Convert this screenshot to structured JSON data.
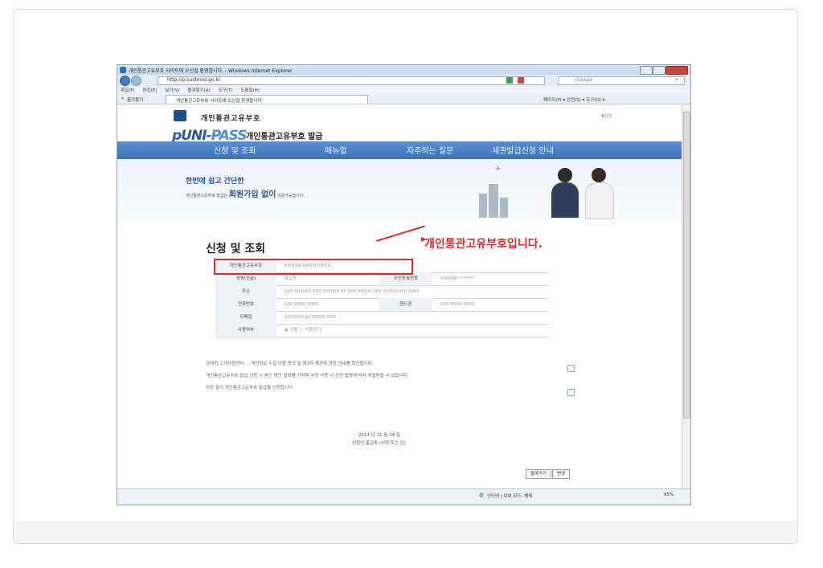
{
  "browser": {
    "window_title": "개인통관고유부호 사이트에 오신걸 환영합니다. - Windows Internet Explorer",
    "url": "http://p.customs.go.kr",
    "search_placeholder": "Google",
    "menu": [
      "파일(F)",
      "편집(E)",
      "보기(V)",
      "즐겨찾기(A)",
      "도구(T)",
      "도움말(H)"
    ],
    "favorites_label": "즐겨찾기",
    "tab_title": "개인통관고유부호 사이트에 오신걸 환영합니다",
    "toolbar_right": "페이지(P) ▾ 안전(S) ▾ 도구(O) ▾",
    "status_zone": "인터넷 | 보호 모드: 해제",
    "zoom": "95%"
  },
  "site": {
    "name": "개인통관고유부호",
    "brand_main": "pUNI-",
    "brand_pass": "PASS",
    "brand_sub": "개인통관고유부호 발급",
    "login": "로그인",
    "nav": [
      "신청 및 조회",
      "매뉴얼",
      "자주하는 질문",
      "세관발급신청 안내"
    ],
    "hero_line1_a": "한번에 쉽고 ",
    "hero_line1_b": "간단한",
    "hero_line2_a": "개인통관고유부호 발급은 ",
    "hero_line2_b": "회원가입 없이",
    "hero_line2_c": " 이용가능합니다."
  },
  "main": {
    "title": "신청 및 조회",
    "callout": "개인통관고유부호입니다.",
    "rows": [
      {
        "label": "개인통관고유부호",
        "value": "P000000000000"
      },
      {
        "label": "성명(한글)",
        "value": "홍길동",
        "label2": "주민등록번호",
        "value2": "000000-*******"
      },
      {
        "label": "주소",
        "value": "000 000000 000 000000 00 000 00000 000 00000 000 0000"
      },
      {
        "label": "전화번호",
        "value": "000-0000-0000",
        "label2": "핸드폰",
        "value2": "000-0000-0000"
      },
      {
        "label": "이메일",
        "value": "0000000@000000.000"
      },
      {
        "label": "사용여부",
        "value": "◉ 사용  ○ 사용정지"
      }
    ],
    "notice1": "관세청 고객지원센터 ... 개인정보 수집·이용 동의 및 제3자 제공에 관한 안내를 확인합니다.",
    "notice2": "개인통관고유부호 발급 신청 시 본인 확인 절차를 거치며 부정 사용 시 관련 법령에 따라 처벌받을 수 있습니다.",
    "notice3": "위와 같이 개인통관고유부호 발급을 신청합니다.",
    "date": "2014 년 11 월 24 일",
    "applicant": "신청인  홍길동 (서명 또는 인)",
    "buttons": [
      "돌아가기",
      "변경"
    ]
  }
}
